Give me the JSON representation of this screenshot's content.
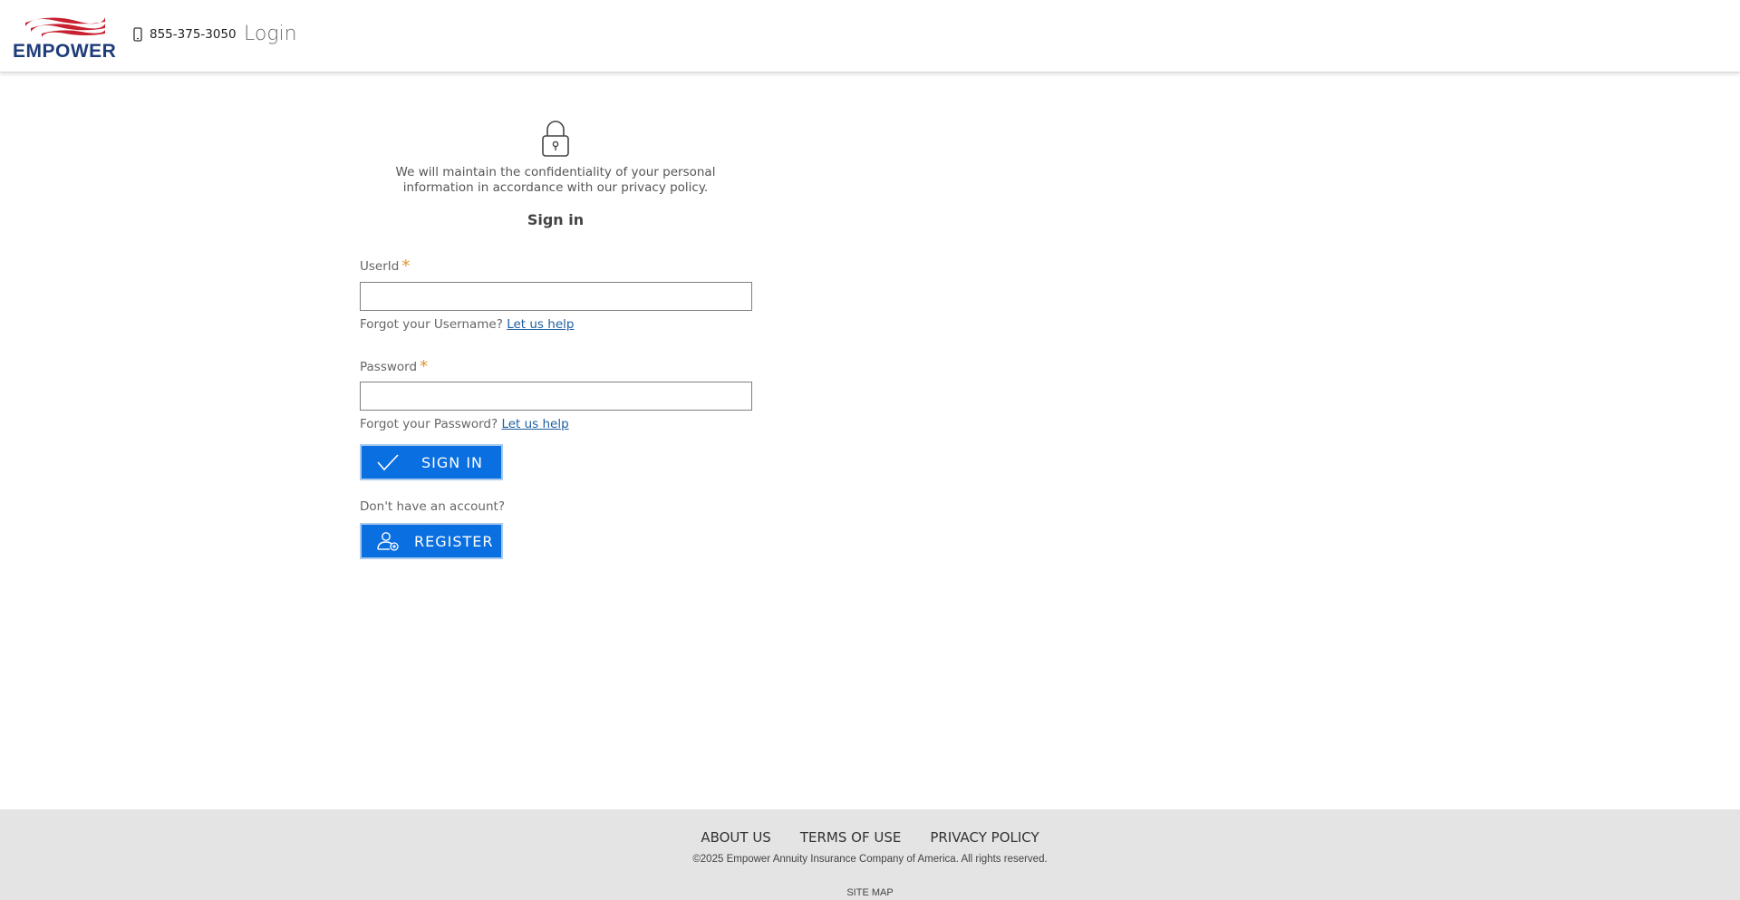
{
  "header": {
    "logo_text": "EMPOWER",
    "phone": "855-375-3050",
    "title": "Login"
  },
  "login": {
    "privacy_notice": "We will maintain the confidentiality of your personal information in accordance with our privacy policy.",
    "heading": "Sign in",
    "userid_label": "UserId",
    "userid_value": "",
    "username_help_text": "Forgot your Username?",
    "username_help_link": "Let us help",
    "password_label": "Password",
    "password_value": "",
    "password_help_text": "Forgot your Password?",
    "password_help_link": "Let us help",
    "required_marker": "*",
    "sign_in_button": "SIGN IN",
    "no_account_text": "Don't have an account?",
    "register_button": "REGISTER"
  },
  "footer": {
    "links": [
      "ABOUT US",
      "TERMS OF USE",
      "PRIVACY POLICY"
    ],
    "copyright": "©2025 Empower Annuity Insurance Company of America. All rights reserved.",
    "sitemap": "SITE MAP"
  },
  "colors": {
    "primary_button": "#0a6fe0",
    "link": "#1f5f9e",
    "required": "#e0952a",
    "brand_red": "#c8202f",
    "brand_navy": "#1f3d7a",
    "footer_bg": "#e4e4e4"
  },
  "icons": {
    "logo_flag": "flag-stripes-icon",
    "phone": "mobile-phone-icon",
    "lock": "lock-icon",
    "sign_in": "checkmark-icon",
    "register": "user-add-icon"
  }
}
